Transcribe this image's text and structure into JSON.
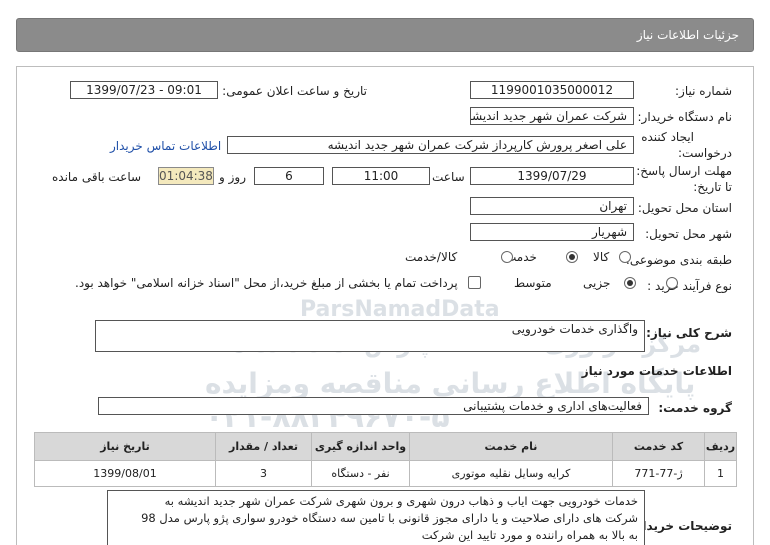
{
  "header": {
    "title": "جزئیات اطلاعات نیاز"
  },
  "form": {
    "need_number_label": "شماره نیاز:",
    "need_number": "1199001035000012",
    "announce_label": "تاریخ و ساعت اعلان عمومی:",
    "announce_value": "1399/07/23 - 09:01",
    "buyer_label": "نام دستگاه خریدار:",
    "buyer_value": "شرکت عمران شهر جدید اندیشه",
    "creator_label_1": "ایجاد کننده",
    "creator_label_2": "درخواست:",
    "creator_value": "علی اصغر پرورش کارپرداز شرکت عمران شهر جدید اندیشه",
    "contact_link": "اطلاعات تماس خریدار",
    "deadline_label_1": "مهلت ارسال پاسخ:",
    "deadline_label_2": "تا تاریخ:",
    "deadline_date": "1399/07/29",
    "time_label": "ساعت",
    "deadline_time": "11:00",
    "days_value": "6",
    "days_label": "روز و",
    "remaining_time": "01:04:38",
    "remaining_label": "ساعت باقی مانده",
    "province_label": "استان محل تحویل:",
    "province_value": "تهران",
    "city_label": "شهر محل تحویل:",
    "city_value": "شهریار",
    "category_label": "طبقه بندی موضوعی:",
    "category_options": [
      "کالا",
      "خدمت",
      "کالا/خدمت"
    ],
    "category_selected": "خدمت",
    "process_label": "نوع فرآیند خرید :",
    "process_options": [
      "جزیی",
      "متوسط"
    ],
    "process_selected": "متوسط",
    "payment_note": "پرداخت تمام یا بخشی از مبلغ خرید،از محل \"اسناد خزانه اسلامی\" خواهد بود."
  },
  "watermark": {
    "line1": "ParsNamadData",
    "line2": "مرکز فراوری اطلاعات پارس نماد داده ها",
    "line3": "پایگاه اطلاع رسانی مناقصه ومزایده",
    "line4": "۰۲۱-۸۸۳۴۹۶۷۰-۵"
  },
  "summary": {
    "label": "شرح کلی نیاز:",
    "value": "واگذاری خدمات خودرویی"
  },
  "services_title": "اطلاعات خدمات مورد نیاز",
  "service_group": {
    "label": "گروه خدمت:",
    "value": "فعالیت‌های اداری و خدمات پشتیبانی"
  },
  "table": {
    "headers": [
      "ردیف",
      "کد خدمت",
      "نام خدمت",
      "واحد اندازه گیری",
      "تعداد / مقدار",
      "تاریخ نیاز"
    ],
    "rows": [
      [
        "1",
        "ژ-77-771",
        "کرایه وسایل نقلیه موتوری",
        "نفر - دستگاه",
        "3",
        "1399/08/01"
      ]
    ]
  },
  "notes": {
    "label": "توضیحات خریدار:",
    "line1": "خدمات خودرویی جهت ایاب و ذهاب درون شهری و برون شهری شرکت عمران شهر جدید اندیشه به",
    "line2": "شرکت های دارای صلاحیت و یا دارای مجوز قانونی با تامین سه دستگاه خودرو سواری پژو پارس مدل 98",
    "line3": "به بالا به همراه راننده و مورد تایید این شرکت"
  }
}
